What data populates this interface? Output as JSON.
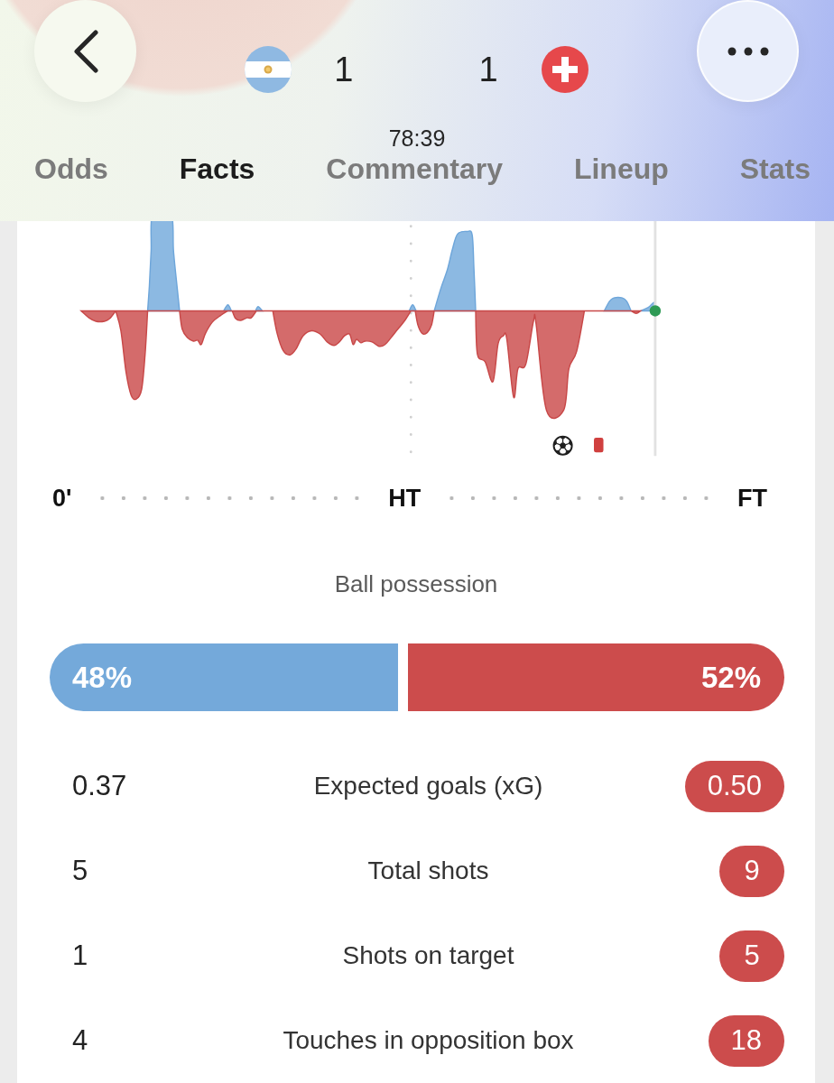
{
  "header": {
    "home": {
      "score": "1"
    },
    "away": {
      "score": "1"
    },
    "match_clock": "78:39",
    "tabs": [
      {
        "label": "Odds",
        "selected": false
      },
      {
        "label": "Facts",
        "selected": true
      },
      {
        "label": "Commentary",
        "selected": false
      },
      {
        "label": "Lineup",
        "selected": false
      },
      {
        "label": "Stats",
        "selected": false
      }
    ]
  },
  "momentum": {
    "axis_labels": [
      "0'",
      "HT",
      "FT"
    ]
  },
  "possession": {
    "title": "Ball possession",
    "home": {
      "level": 0.48,
      "label": "48%"
    },
    "away": {
      "level": 0.52,
      "label": "52%"
    }
  },
  "stats": [
    {
      "label": "Expected goals (xG)",
      "home": {
        "value": "0.37",
        "highlighted": false
      },
      "away": {
        "value": "0.50",
        "highlighted": true
      }
    },
    {
      "label": "Total shots",
      "home": {
        "value": "5",
        "highlighted": false
      },
      "away": {
        "value": "9",
        "highlighted": true
      }
    },
    {
      "label": "Shots on target",
      "home": {
        "value": "1",
        "highlighted": false
      },
      "away": {
        "value": "5",
        "highlighted": true
      }
    },
    {
      "label": "Touches in opposition box",
      "home": {
        "value": "4",
        "highlighted": false
      },
      "away": {
        "value": "18",
        "highlighted": true
      }
    }
  ]
}
